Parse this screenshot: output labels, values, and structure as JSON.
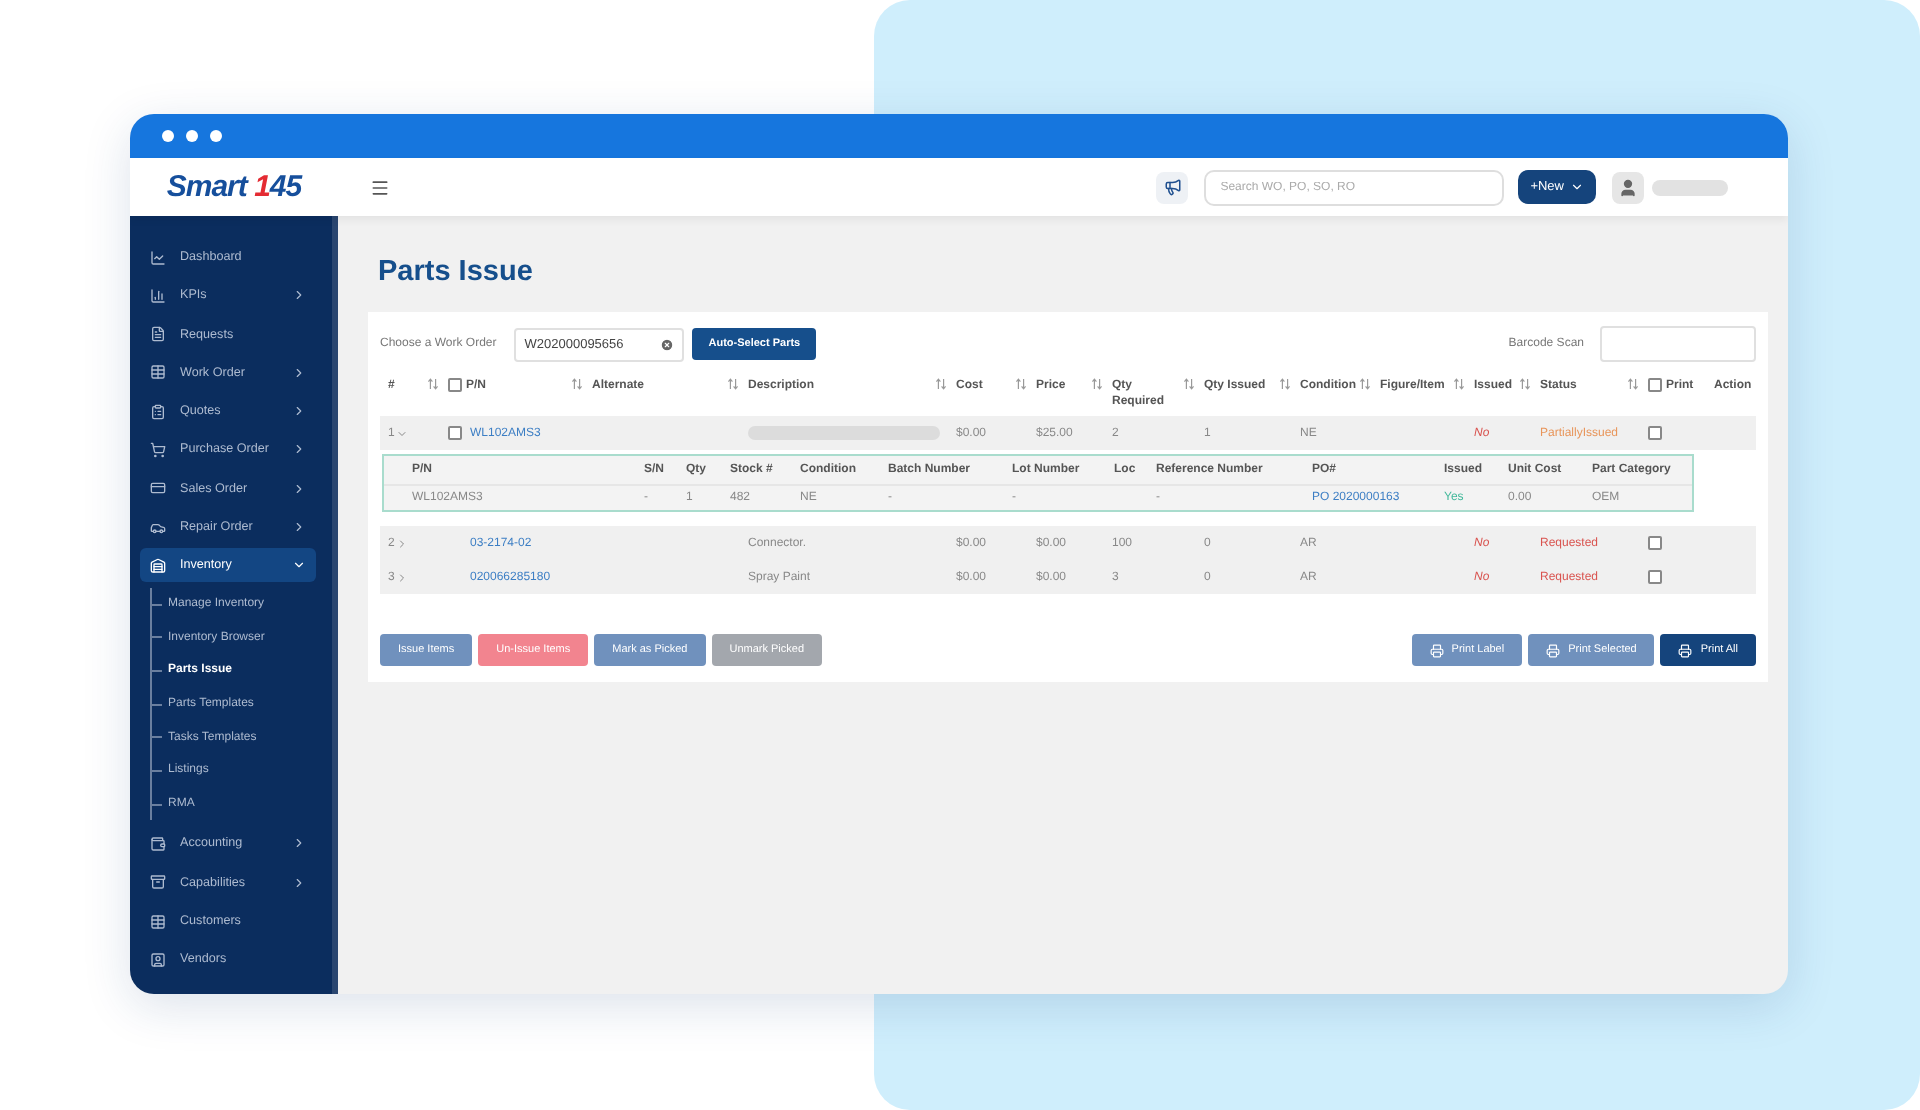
{
  "logo": {
    "word": "Smart",
    "number": "145"
  },
  "header": {
    "search": {
      "placeholder": "Search WO, PO, SO, RO"
    },
    "new_button": "+New"
  },
  "sidebar": {
    "items": [
      {
        "label": "Dashboard",
        "kind": "link",
        "selected": false
      },
      {
        "label": "KPIs",
        "kind": "menu",
        "selected": false,
        "expanded": false
      },
      {
        "label": "Requests",
        "kind": "link",
        "selected": false
      },
      {
        "label": "Work Order",
        "kind": "menu",
        "selected": false,
        "expanded": false
      },
      {
        "label": "Quotes",
        "kind": "menu",
        "selected": false,
        "expanded": false
      },
      {
        "label": "Purchase Order",
        "kind": "menu",
        "selected": false,
        "expanded": false
      },
      {
        "label": "Sales Order",
        "kind": "menu",
        "selected": false,
        "expanded": false
      },
      {
        "label": "Repair Order",
        "kind": "menu",
        "selected": false,
        "expanded": false
      },
      {
        "label": "Inventory",
        "kind": "menu",
        "selected": true,
        "expanded": true,
        "children": [
          {
            "label": "Manage Inventory",
            "selected": false
          },
          {
            "label": "Inventory Browser",
            "selected": false
          },
          {
            "label": "Parts Issue",
            "selected": true
          },
          {
            "label": "Parts Templates",
            "selected": false
          },
          {
            "label": "Tasks Templates",
            "selected": false
          },
          {
            "label": "Listings",
            "selected": false
          },
          {
            "label": "RMA",
            "selected": false
          }
        ]
      },
      {
        "label": "Accounting",
        "kind": "menu",
        "selected": false,
        "expanded": false
      },
      {
        "label": "Capabilities",
        "kind": "menu",
        "selected": false,
        "expanded": false
      },
      {
        "label": "Customers",
        "kind": "link",
        "selected": false
      },
      {
        "label": "Vendors",
        "kind": "link",
        "selected": false
      }
    ]
  },
  "page": {
    "title": "Parts Issue",
    "work_order": {
      "label": "Choose a Work Order",
      "value": "W202000095656"
    },
    "auto_select_button": "Auto-Select Parts",
    "barcode": {
      "label": "Barcode Scan"
    },
    "table": {
      "columns": [
        {
          "label": "#",
          "sortable": true
        },
        {
          "label": "P/N",
          "sortable": true,
          "checkbox": {
            "checked": false
          }
        },
        {
          "label": "Alternate",
          "sortable": true
        },
        {
          "label": "Description",
          "sortable": true
        },
        {
          "label": "Cost",
          "sortable": true
        },
        {
          "label": "Price",
          "sortable": true
        },
        {
          "label": "Qty Required",
          "sortable": true
        },
        {
          "label": "Qty Issued",
          "sortable": true
        },
        {
          "label": "Condition",
          "sortable": true
        },
        {
          "label": "Figure/Item",
          "sortable": true
        },
        {
          "label": "Issued",
          "sortable": true
        },
        {
          "label": "Status",
          "sortable": true
        },
        {
          "label": "Print",
          "sortable": false,
          "checkbox": {
            "checked": false
          }
        },
        {
          "label": "Action",
          "sortable": false
        }
      ],
      "rows": [
        {
          "number": "1",
          "expanded": true,
          "select": {
            "checked": false
          },
          "pn": "WL102AMS3",
          "description_hidden": true,
          "cost": "$0.00",
          "price": "$25.00",
          "qty_required": "2",
          "qty_issued": "1",
          "condition": "NE",
          "issued": "No",
          "status": "PartiallyIssued",
          "color": "#e8955a",
          "print": {
            "checked": false
          },
          "detail": {
            "columns": [
              {
                "label": "P/N",
                "kind": "text"
              },
              {
                "label": "S/N",
                "kind": "text"
              },
              {
                "label": "Qty",
                "kind": "text"
              },
              {
                "label": "Stock #",
                "kind": "text"
              },
              {
                "label": "Condition",
                "kind": "text"
              },
              {
                "label": "Batch Number",
                "kind": "text"
              },
              {
                "label": "Lot Number",
                "kind": "text"
              },
              {
                "label": "Loc",
                "kind": "text"
              },
              {
                "label": "Reference Number",
                "kind": "text"
              },
              {
                "label": "PO#",
                "kind": "link"
              },
              {
                "label": "Issued",
                "kind": "good"
              },
              {
                "label": "Unit Cost",
                "kind": "text"
              },
              {
                "label": "Part Category",
                "kind": "text"
              }
            ],
            "rows": [
              [
                "WL102AMS3",
                "-",
                "1",
                "482",
                "NE",
                "-",
                "-",
                "",
                "-",
                "PO 2020000163",
                "Yes",
                "0.00",
                "OEM"
              ]
            ]
          }
        },
        {
          "number": "2",
          "expanded": false,
          "pn": "03-2174-02",
          "description_hidden": false,
          "description": "Connector.",
          "cost": "$0.00",
          "price": "$0.00",
          "qty_required": "100",
          "qty_issued": "0",
          "condition": "AR",
          "issued": "No",
          "status": "Requested",
          "color": "#d9534f",
          "print": {
            "checked": false
          }
        },
        {
          "number": "3",
          "expanded": false,
          "pn": "020066285180",
          "description_hidden": false,
          "description": "Spray Paint",
          "cost": "$0.00",
          "price": "$0.00",
          "qty_required": "3",
          "qty_issued": "0",
          "condition": "AR",
          "issued": "No",
          "status": "Requested",
          "color": "#d9534f",
          "print": {
            "checked": false
          }
        }
      ]
    },
    "actions_left": [
      {
        "label": "Issue Items",
        "color": "#7091bd"
      },
      {
        "label": "Un-Issue Items",
        "color": "#f2848f"
      },
      {
        "label": "Mark as Picked",
        "color": "#7091bd"
      },
      {
        "label": "Unmark Picked",
        "color": "#a3a7ad"
      }
    ],
    "actions_right": [
      {
        "label": "Print Label",
        "color": "#7091bd"
      },
      {
        "label": "Print Selected",
        "color": "#7091bd"
      },
      {
        "label": "Print All",
        "color": "#15447c"
      }
    ]
  }
}
